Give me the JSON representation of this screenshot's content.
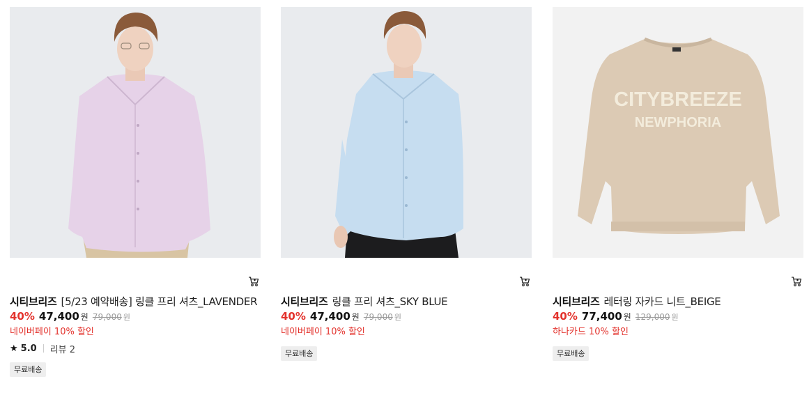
{
  "products": [
    {
      "brand": "시티브리즈",
      "name": "[5/23 예약배송] 링클 프리 셔츠_LAVENDER",
      "discount": "40%",
      "price": "47,400",
      "currency": "원",
      "original_price": "79,000",
      "promo": "네이버페이 10% 할인",
      "rating": "5.0",
      "reviews": "리뷰 2",
      "badge": "무료배송",
      "colors": {
        "bg": "#e8eaee",
        "garment": "#e4cfe6"
      }
    },
    {
      "brand": "시티브리즈",
      "name": "링클 프리 셔츠_SKY BLUE",
      "discount": "40%",
      "price": "47,400",
      "currency": "원",
      "original_price": "79,000",
      "promo": "네이버페이 10% 할인",
      "badge": "무료배송",
      "colors": {
        "bg": "#e8eaee",
        "garment": "#c4dcef"
      }
    },
    {
      "brand": "시티브리즈",
      "name": "레터링 자카드 니트_BEIGE",
      "discount": "40%",
      "price": "77,400",
      "currency": "원",
      "original_price": "129,000",
      "promo": "하나카드 10% 할인",
      "badge": "무료배송",
      "colors": {
        "bg": "#f1f1f1",
        "garment": "#dccab4"
      },
      "print_text": [
        "CITYBREEZE",
        "NEWPHORIA"
      ]
    }
  ],
  "icons": {
    "cart": "cart-icon",
    "star": "star-icon"
  },
  "theme": {
    "accent": "#e3322c"
  }
}
